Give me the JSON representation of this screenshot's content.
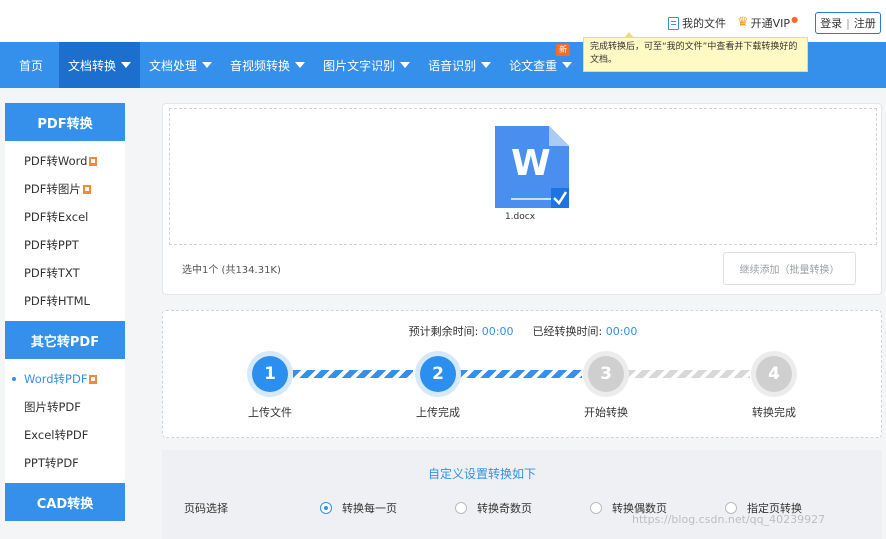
{
  "header": {
    "my_files": "我的文件",
    "vip": "开通VIP",
    "login": "登录",
    "separator": "|",
    "register": "注册"
  },
  "nav": {
    "items": [
      {
        "label": "首页",
        "dropdown": false
      },
      {
        "label": "文档转换",
        "dropdown": true,
        "active": true
      },
      {
        "label": "文档处理",
        "dropdown": true
      },
      {
        "label": "音视频转换",
        "dropdown": true
      },
      {
        "label": "图片文字识别",
        "dropdown": true
      },
      {
        "label": "语音识别",
        "dropdown": true
      },
      {
        "label": "论文查重",
        "dropdown": true,
        "badge": "新"
      }
    ]
  },
  "tooltip": {
    "text": "完成转换后，可至“我的文件”中查看并下载转换好的文档。"
  },
  "sidebar": {
    "sections": [
      {
        "title": "PDF转换",
        "items": [
          "PDF转Word",
          "PDF转图片",
          "PDF转Excel",
          "PDF转PPT",
          "PDF转TXT",
          "PDF转HTML"
        ]
      },
      {
        "title": "其它转PDF",
        "items": [
          "Word转PDF",
          "图片转PDF",
          "Excel转PDF",
          "PPT转PDF"
        ]
      },
      {
        "title": "CAD转换",
        "items": []
      }
    ],
    "active_item": "Word转PDF"
  },
  "upload": {
    "file_icon_letter": "W",
    "file_name": "1.docx",
    "selected_info": "选中1个  (共134.31K)",
    "continue_button": "继续添加（批量转换）"
  },
  "progress": {
    "remaining_label": "预计剩余时间:",
    "remaining_value": "00:00",
    "elapsed_label": "已经转换时间:",
    "elapsed_value": "00:00",
    "steps": [
      {
        "num": "1",
        "label": "上传文件",
        "done": true
      },
      {
        "num": "2",
        "label": "上传完成",
        "done": true
      },
      {
        "num": "3",
        "label": "开始转换",
        "done": false
      },
      {
        "num": "4",
        "label": "转换完成",
        "done": false
      }
    ]
  },
  "settings": {
    "title": "自定义设置转换如下",
    "page_label": "页码选择",
    "options": [
      "转换每一页",
      "转换奇数页",
      "转换偶数页",
      "指定页转换"
    ],
    "selected_option": "转换每一页"
  },
  "watermark": "https://blog.csdn.net/qq_40239927",
  "colors": {
    "primary": "#3490ea",
    "nav_active": "#1c6fcc",
    "accent_orange": "#f56c2a",
    "tooltip_bg": "#fff9c4"
  }
}
